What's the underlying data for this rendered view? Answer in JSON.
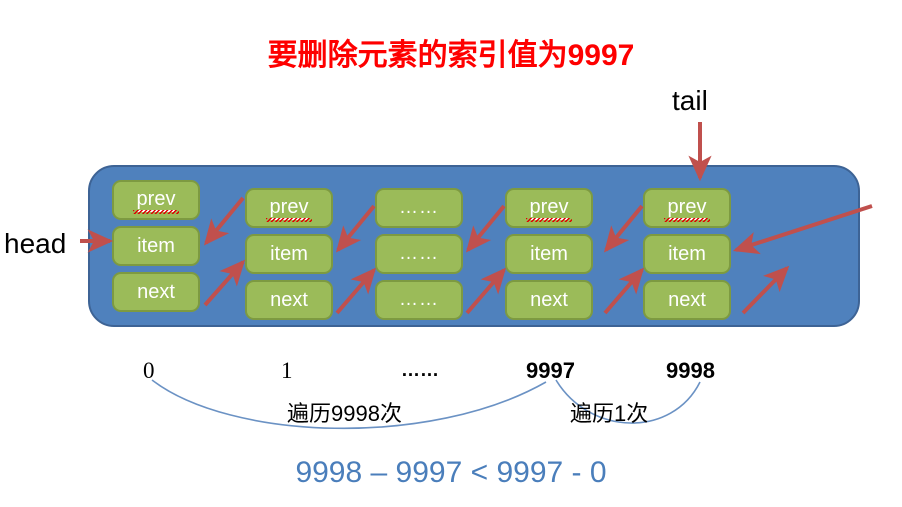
{
  "title": "要删除元素的索引值为9997",
  "pointers": {
    "head": "head",
    "tail": "tail",
    "null": "null"
  },
  "colors": {
    "title_red": "#fe0000",
    "container_blue": "#4f81bd",
    "node_green": "#9bbb59",
    "arrow_red": "#c0504d",
    "brace_blue": "#6b92c4",
    "formula_blue": "#4a7ebb"
  },
  "nodes": [
    {
      "id": "node-0",
      "prev": "prev",
      "item": "item",
      "next": "next",
      "index": "0"
    },
    {
      "id": "node-1",
      "prev": "prev",
      "item": "item",
      "next": "next",
      "index": "1"
    },
    {
      "id": "node-ellipsis",
      "prev": "……",
      "item": "……",
      "next": "……",
      "index": "……"
    },
    {
      "id": "node-9997",
      "prev": "prev",
      "item": "item",
      "next": "next",
      "index": "9997"
    },
    {
      "id": "node-9998",
      "prev": "prev",
      "item": "item",
      "next": "next",
      "index": "9998"
    }
  ],
  "braces": [
    {
      "id": "brace-left",
      "caption": "遍历9998次"
    },
    {
      "id": "brace-right",
      "caption": "遍历1次"
    }
  ],
  "formula": "9998 – 9997 < 9997 - 0"
}
